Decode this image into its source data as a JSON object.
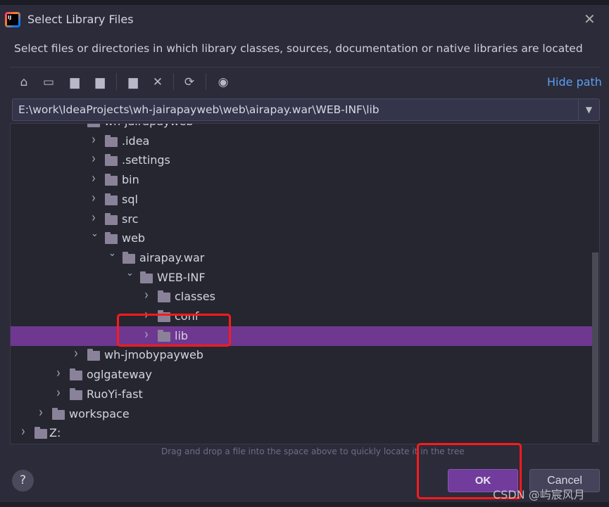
{
  "dialog": {
    "title": "Select Library Files",
    "description": "Select files or directories in which library classes, sources, documentation or native libraries are located"
  },
  "toolbar": {
    "icons": [
      "home-icon",
      "desktop-icon",
      "project-folder-icon",
      "module-folder-icon",
      "new-folder-icon",
      "delete-icon",
      "refresh-icon",
      "show-hidden-icon"
    ],
    "hide_path": "Hide path"
  },
  "path": {
    "value": "E:\\work\\IdeaProjects\\wh-jairapayweb\\web\\airapay.war\\WEB-INF\\lib"
  },
  "tree": {
    "items": [
      {
        "label": "wh-jairapayweb",
        "level": 4,
        "expanded": true
      },
      {
        "label": ".idea",
        "level": 5
      },
      {
        "label": ".settings",
        "level": 5
      },
      {
        "label": "bin",
        "level": 5
      },
      {
        "label": "sql",
        "level": 5
      },
      {
        "label": "src",
        "level": 5
      },
      {
        "label": "web",
        "level": 5,
        "expanded": true
      },
      {
        "label": "airapay.war",
        "level": 6,
        "expanded": true
      },
      {
        "label": "WEB-INF",
        "level": 7,
        "expanded": true
      },
      {
        "label": "classes",
        "level": 8
      },
      {
        "label": "conf",
        "level": 8
      },
      {
        "label": "lib",
        "level": 8,
        "selected": true
      },
      {
        "label": "wh-jmobypayweb",
        "level": 4
      },
      {
        "label": "oglgateway",
        "level": 3
      },
      {
        "label": "RuoYi-fast",
        "level": 3
      },
      {
        "label": "workspace",
        "level": 2
      },
      {
        "label": "Z:",
        "level": 1,
        "drive": true
      }
    ]
  },
  "hint": "Drag and drop a file into the space above to quickly locate it in the tree",
  "buttons": {
    "help": "?",
    "ok": "OK",
    "cancel": "Cancel"
  },
  "watermark": "CSDN @屿宸风月",
  "colors": {
    "selection": "#6e3790",
    "accent_link": "#5aa0f0",
    "highlight_box": "#ff1a1a"
  }
}
